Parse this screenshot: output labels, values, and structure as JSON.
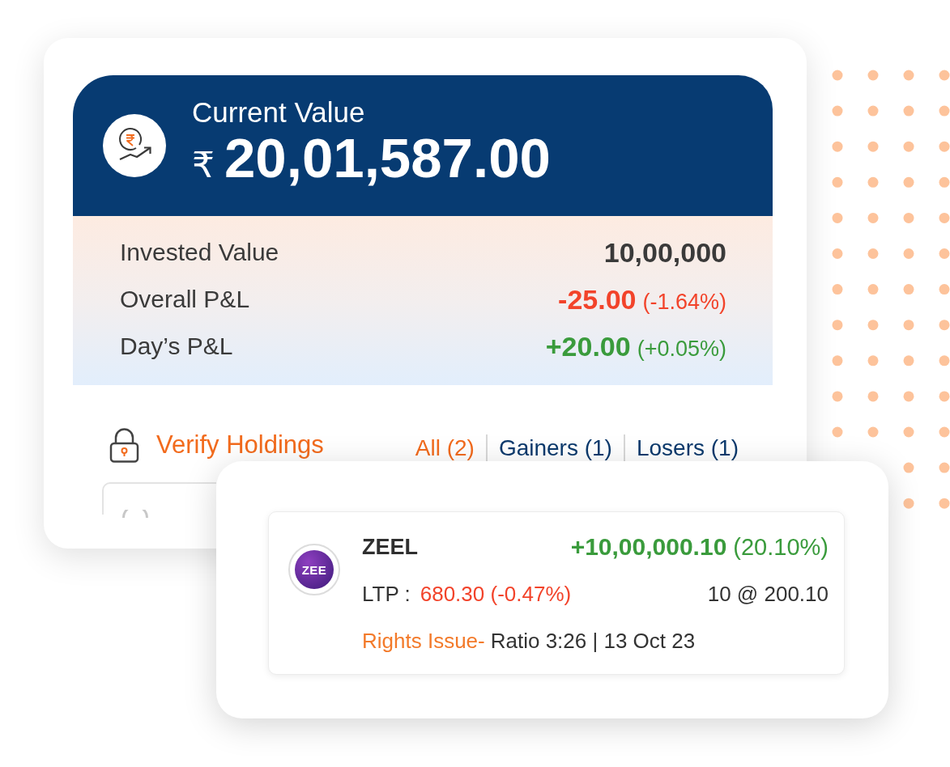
{
  "current_value": {
    "label": "Current Value",
    "currency": "₹",
    "amount": "20,01,587.00"
  },
  "summary": [
    {
      "label": "Invested Value",
      "value": "10,00,000",
      "kind": "neutral"
    },
    {
      "label": "Overall P&L",
      "value": "-25.00",
      "change": "(-1.64%)",
      "kind": "loss"
    },
    {
      "label": "Day’s P&L",
      "value": "+20.00",
      "change": "(+0.05%)",
      "kind": "gain"
    }
  ],
  "verify_link": "Verify Holdings",
  "filter_tabs": [
    {
      "label": "All (2)",
      "selected": true
    },
    {
      "label": "Gainers (1)",
      "selected": false
    },
    {
      "label": "Losers (1)",
      "selected": false
    }
  ],
  "holding": {
    "logo_text": "ZEE",
    "symbol": "ZEEL",
    "pnl": {
      "value": "+10,00,000.10",
      "change": "(20.10%)",
      "kind": "gain"
    },
    "ltp": {
      "label": "LTP :",
      "value": "680.30 (-0.47%)",
      "kind": "loss"
    },
    "quantity": "10 @ 200.10",
    "action_label": "Rights Issue-",
    "action_detail": "Ratio 3:26 | 13 Oct 23"
  }
}
